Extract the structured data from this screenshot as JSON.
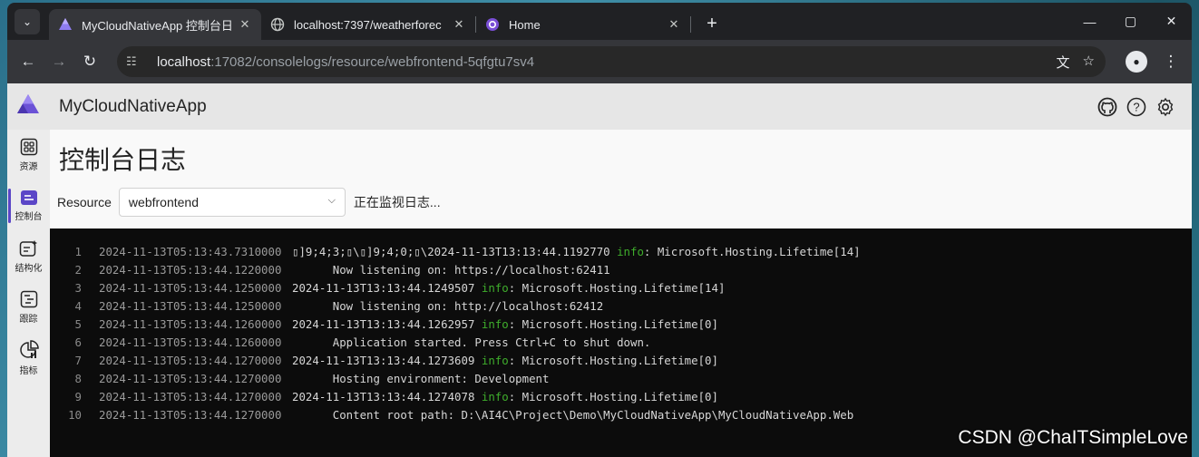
{
  "browser": {
    "tabs": [
      {
        "title": "MyCloudNativeApp 控制台日",
        "active": true
      },
      {
        "title": "localhost:7397/weatherforec",
        "active": false
      },
      {
        "title": "Home",
        "active": false
      }
    ],
    "new_tab": "+",
    "url_host": "localhost",
    "url_path": ":17082/consolelogs/resource/webfrontend-5qfgtu7sv4"
  },
  "app": {
    "title": "MyCloudNativeApp"
  },
  "nav": {
    "items": [
      {
        "label": "资源",
        "icon": "grid-icon"
      },
      {
        "label": "控制台",
        "icon": "console-icon"
      },
      {
        "label": "结构化",
        "icon": "structured-icon"
      },
      {
        "label": "跟踪",
        "icon": "trace-icon"
      },
      {
        "label": "指标",
        "icon": "chart-icon"
      }
    ]
  },
  "page": {
    "title": "控制台日志",
    "resource_label": "Resource",
    "resource_value": "webfrontend",
    "status": "正在监视日志..."
  },
  "logs": [
    {
      "n": "1",
      "ts": "2024-11-13T05:13:43.7310000",
      "pre": "▯]9;4;3;▯\\▯]9;4;0;▯\\2024-11-13T13:13:44.1192770 ",
      "level": "info",
      "post": ": Microsoft.Hosting.Lifetime[14]"
    },
    {
      "n": "2",
      "ts": "2024-11-13T05:13:44.1220000",
      "pre": "      Now listening on: https://localhost:62411",
      "level": "",
      "post": ""
    },
    {
      "n": "3",
      "ts": "2024-11-13T05:13:44.1250000",
      "pre": "2024-11-13T13:13:44.1249507 ",
      "level": "info",
      "post": ": Microsoft.Hosting.Lifetime[14]"
    },
    {
      "n": "4",
      "ts": "2024-11-13T05:13:44.1250000",
      "pre": "      Now listening on: http://localhost:62412",
      "level": "",
      "post": ""
    },
    {
      "n": "5",
      "ts": "2024-11-13T05:13:44.1260000",
      "pre": "2024-11-13T13:13:44.1262957 ",
      "level": "info",
      "post": ": Microsoft.Hosting.Lifetime[0]"
    },
    {
      "n": "6",
      "ts": "2024-11-13T05:13:44.1260000",
      "pre": "      Application started. Press Ctrl+C to shut down.",
      "level": "",
      "post": ""
    },
    {
      "n": "7",
      "ts": "2024-11-13T05:13:44.1270000",
      "pre": "2024-11-13T13:13:44.1273609 ",
      "level": "info",
      "post": ": Microsoft.Hosting.Lifetime[0]"
    },
    {
      "n": "8",
      "ts": "2024-11-13T05:13:44.1270000",
      "pre": "      Hosting environment: Development",
      "level": "",
      "post": ""
    },
    {
      "n": "9",
      "ts": "2024-11-13T05:13:44.1270000",
      "pre": "2024-11-13T13:13:44.1274078 ",
      "level": "info",
      "post": ": Microsoft.Hosting.Lifetime[0]"
    },
    {
      "n": "10",
      "ts": "2024-11-13T05:13:44.1270000",
      "pre": "      Content root path: D:\\AI4C\\Project\\Demo\\MyCloudNativeApp\\MyCloudNativeApp.Web",
      "level": "",
      "post": ""
    }
  ],
  "watermark": "CSDN @ChaITSimpleLove",
  "colors": {
    "accent": "#5b46c7",
    "info": "#3fae2c",
    "console_bg": "#0c0c0c"
  }
}
